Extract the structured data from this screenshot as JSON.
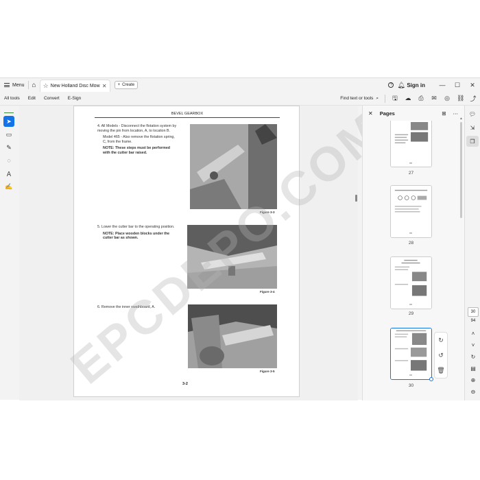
{
  "titlebar": {
    "menu_label": "Menu",
    "tab_title": "New Holland Disc Mow...",
    "create_label": "Create",
    "signin_label": "Sign in"
  },
  "toolbar": {
    "items": [
      "All tools",
      "Edit",
      "Convert",
      "E-Sign"
    ],
    "find_label": "Find text or tools"
  },
  "document": {
    "header": "BEVEL GEARBOX",
    "step4_line1": "4. All Models - Disconnect the flotation system by moving the pin from location, A, to location B.",
    "step4_line2": "Model 465 - Also remove the flotation spring, C, from the frame.",
    "step4_note": "NOTE: These steps must be performed with the cutter bar raised.",
    "fig1": "Figure 3-3",
    "step5_line1": "5. Lower the cutter bar to the operating position.",
    "step5_note": "NOTE: Place wooden blocks under the cutter bar as shown.",
    "fig2": "Figure 3-4",
    "step6_line1": "6. Remove the inner swathboard, A.",
    "fig3": "Figure 3-5",
    "page_number": "3-2"
  },
  "watermark": "EPCDEPO.COM",
  "pages_panel": {
    "title": "Pages",
    "thumbs": [
      {
        "label": "27"
      },
      {
        "label": "28"
      },
      {
        "label": "29"
      },
      {
        "label": "30"
      }
    ]
  },
  "page_nav": {
    "current": "30",
    "total": "94"
  },
  "colors": {
    "accent": "#1473e6",
    "background": "#f3f3f3"
  }
}
